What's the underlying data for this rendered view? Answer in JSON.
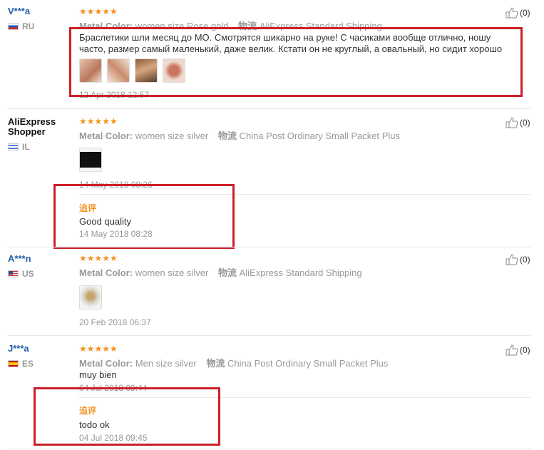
{
  "common": {
    "metal_label": "Metal Color:",
    "ship_label": "物流",
    "addl_label": "追评",
    "stars": "★★★★★"
  },
  "reviews": [
    {
      "user": "V***a",
      "country": "RU",
      "metal": "women size Rose gold",
      "shipping": "AliExpress Standard Shipping",
      "text": "Браслетики шли месяц до МО. Смотрятся шикарно на руке! С часиками вообще отлично, ношу часто, размер самый маленький, даже велик. Кстати он не круглый, а овальный, но сидит хорошо",
      "date": "12 Apr 2018 12:57",
      "helpful": "(0)"
    },
    {
      "user": "AliExpress Shopper",
      "country": "IL",
      "metal": "women size silver",
      "shipping": "China Post Ordinary Small Packet Plus",
      "date": "14 May 2018 08:26",
      "helpful": "(0)",
      "additional": {
        "text": "Good quality",
        "date": "14 May 2018 08:28"
      }
    },
    {
      "user": "A***n",
      "country": "US",
      "metal": "women size silver",
      "shipping": "AliExpress Standard Shipping",
      "date": "20 Feb 2018 06:37",
      "helpful": "(0)"
    },
    {
      "user": "J***a",
      "country": "ES",
      "metal": "Men size silver",
      "shipping": "China Post Ordinary Small Packet Plus",
      "text": "muy bien",
      "date": "04 Jul 2018 09:44",
      "helpful": "(0)",
      "additional": {
        "text": "todo ok",
        "date": "04 Jul 2018 09:45"
      }
    }
  ],
  "colors": {
    "accent": "#f5901e",
    "link": "#1c5fa7",
    "annotation": "#cc1f27"
  }
}
